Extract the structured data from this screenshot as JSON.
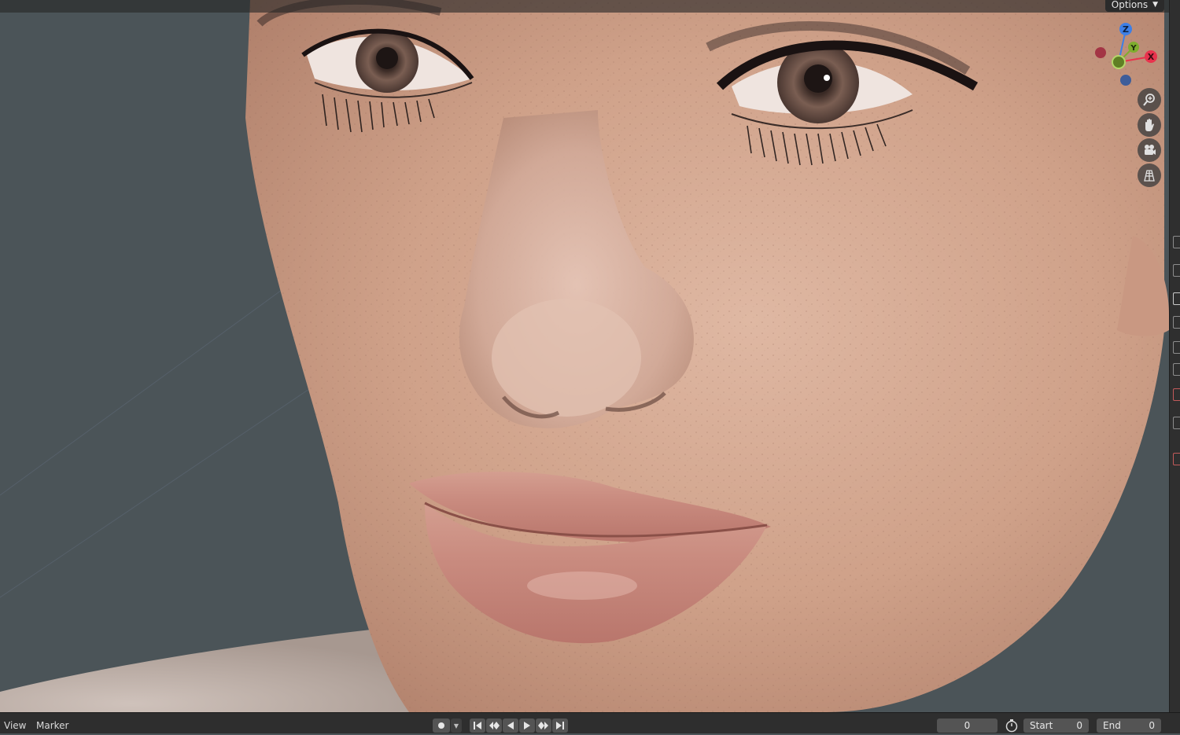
{
  "header": {
    "options_label": "Options"
  },
  "gizmo": {
    "axes": [
      "Z",
      "Y",
      "X"
    ],
    "colors": {
      "x": "#e8334d",
      "y": "#7fad2e",
      "z": "#3d7fe6"
    }
  },
  "nav_icons": [
    "zoom-in-icon",
    "hand-pan-icon",
    "camera-icon",
    "grid-ortho-icon"
  ],
  "timeline": {
    "menu": {
      "view": "View",
      "marker": "Marker"
    },
    "current_frame": "0",
    "start_label": "Start",
    "start_value": "0",
    "end_label": "End",
    "end_value": "0"
  },
  "colors": {
    "viewport_bg": "#4b5458",
    "skin": "#d7ab95",
    "lips": "#c98a7f",
    "timeline_bg": "#2e2e2e"
  }
}
